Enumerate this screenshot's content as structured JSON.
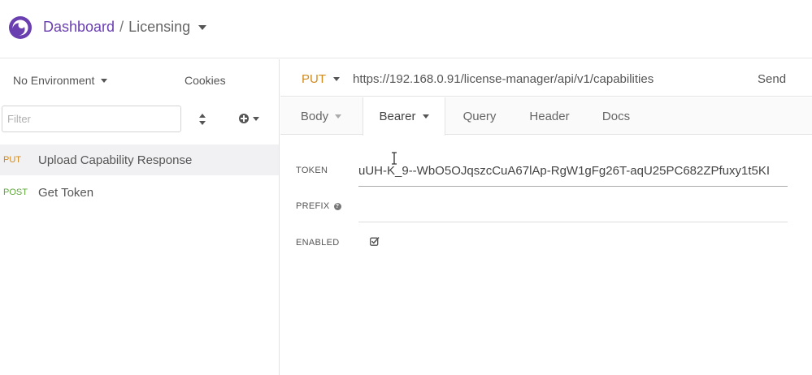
{
  "header": {
    "breadcrumb_root": "Dashboard",
    "breadcrumb_separator": "/",
    "breadcrumb_current": "Licensing",
    "brand_color": "#6a3fb0"
  },
  "sidebar": {
    "environment": "No Environment",
    "cookies": "Cookies",
    "filter_placeholder": "Filter",
    "requests": [
      {
        "method": "PUT",
        "name": "Upload Capability Response",
        "active": true
      },
      {
        "method": "POST",
        "name": "Get Token",
        "active": false
      }
    ]
  },
  "request": {
    "method": "PUT",
    "url": "https://192.168.0.91/license-manager/api/v1/capabilities",
    "send_label": "Send",
    "tabs": [
      "Body",
      "Bearer",
      "Query",
      "Header",
      "Docs"
    ],
    "active_tab": "Bearer"
  },
  "auth": {
    "token_label": "TOKEN",
    "token_value": "uUH-K_9--WbO5OJqszcCuA67lAp-RgW1gFg26T-aqU25PC682ZPfuxy1t5KI",
    "prefix_label": "PREFIX",
    "prefix_value": "",
    "enabled_label": "ENABLED",
    "enabled": true
  },
  "colors": {
    "put": "#d28a1a",
    "post": "#5fa83a"
  }
}
